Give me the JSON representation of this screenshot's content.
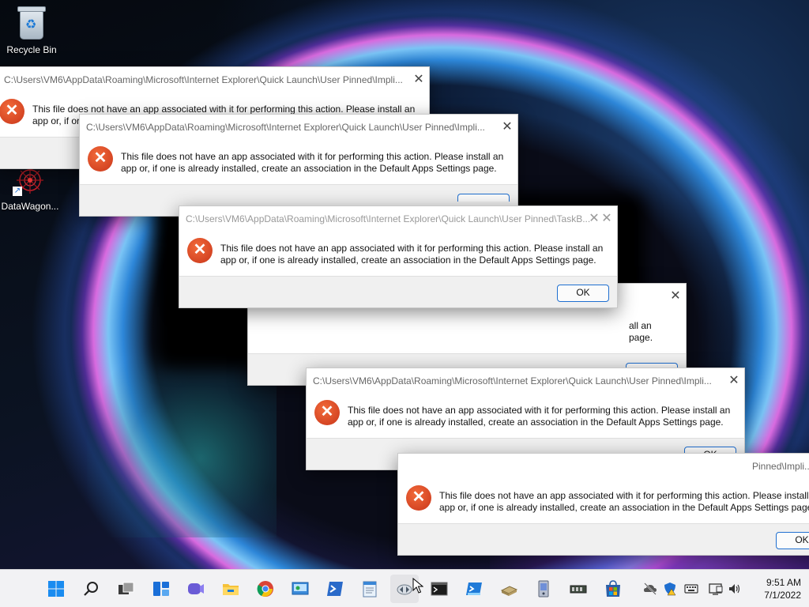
{
  "desktop": {
    "icons": [
      {
        "label": "Recycle Bin"
      },
      {
        "label": "DataWagon..."
      }
    ]
  },
  "dialogs": [
    {
      "title": "C:\\Users\\VM6\\AppData\\Roaming\\Microsoft\\Internet Explorer\\Quick Launch\\User Pinned\\Impli...",
      "line1": "This file does not have an app associated with it for performing this action. Please install an",
      "line2": "app or, if or",
      "ok_label": ""
    },
    {
      "title": "C:\\Users\\VM6\\AppData\\Roaming\\Microsoft\\Internet Explorer\\Quick Launch\\User Pinned\\Impli...",
      "line1": "This file does not have an app associated with it for performing this action. Please install an",
      "line2": "app or, if one is already installed, create an association in the Default Apps Settings page.",
      "ok_label": ""
    },
    {
      "title": "C:\\Users\\VM6\\AppData\\Roaming\\Microsoft\\Internet Explorer\\Quick Launch\\User Pinned\\TaskB...",
      "line1": "This file does not have an app associated with it for performing this action. Please install an",
      "line2": "app or, if one is already installed, create an association in the Default Apps Settings page.",
      "ok_label": "OK"
    },
    {
      "title": "",
      "line1": "all an",
      "line2": "page.",
      "ok_label": ""
    },
    {
      "title": "C:\\Users\\VM6\\AppData\\Roaming\\Microsoft\\Internet Explorer\\Quick Launch\\User Pinned\\Impli...",
      "line1": "This file does not have an app associated with it for performing this action. Please install an",
      "line2": "app or, if one is already installed, create an association in the Default Apps Settings page.",
      "ok_label": "OK"
    },
    {
      "title": "Pinned\\Impli...",
      "line1": "This file does not have an app associated with it for performing this action. Please install a",
      "line2": "app or, if one is already installed, create an association in the Default Apps Settings page.",
      "ok_label": "OK"
    }
  ],
  "close_glyph": "✕",
  "error_glyph": "✕",
  "taskbar": {
    "apps": [
      {
        "icon": "start-icon"
      },
      {
        "icon": "search-icon"
      },
      {
        "icon": "task-view-icon"
      },
      {
        "icon": "widgets-icon"
      },
      {
        "icon": "chat-icon"
      },
      {
        "icon": "file-explorer-icon"
      },
      {
        "icon": "chrome-icon"
      },
      {
        "icon": "control-panel-icon"
      },
      {
        "icon": "powershell-icon"
      },
      {
        "icon": "notepad-icon"
      },
      {
        "icon": "implicit-app-icon"
      },
      {
        "icon": "terminal-icon"
      },
      {
        "icon": "powershell-ise-icon"
      },
      {
        "icon": "disk-icon"
      },
      {
        "icon": "device-icon"
      },
      {
        "icon": "memory-icon"
      },
      {
        "icon": "store-icon"
      }
    ],
    "tray": {
      "time": "9:51 AM",
      "date": "7/1/2022"
    }
  }
}
